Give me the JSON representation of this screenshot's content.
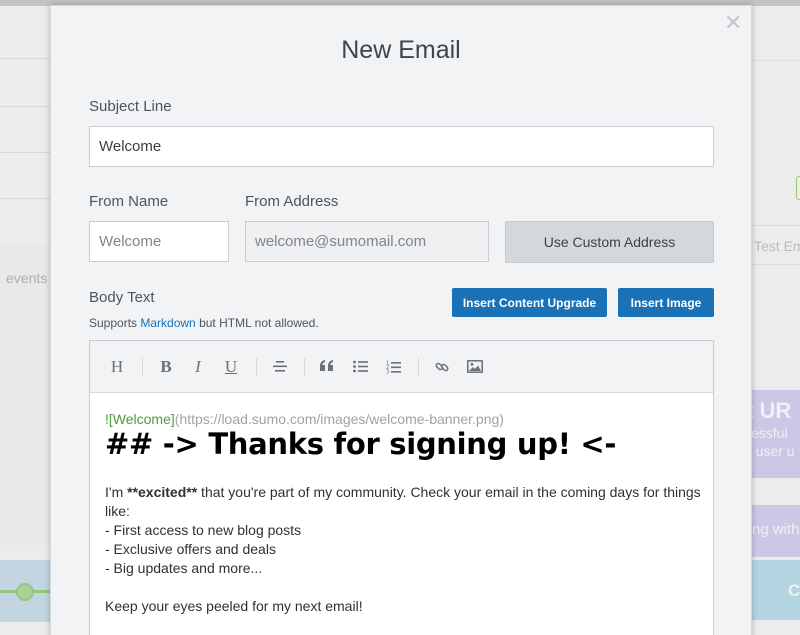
{
  "background": {
    "events_text": "events",
    "test_email_text": "Test Em",
    "purple_title": "t UR",
    "purple_line1": "cessful",
    "purple_line2": "e user u",
    "purple_button": "ng with",
    "cyan_button": "C"
  },
  "modal": {
    "title": "New Email",
    "close_symbol": "✕"
  },
  "subject": {
    "label": "Subject Line",
    "value": "Welcome"
  },
  "from_name": {
    "label": "From Name",
    "placeholder": "Welcome"
  },
  "from_address": {
    "label": "From Address",
    "placeholder": "welcome@sumomail.com"
  },
  "custom_address_button": "Use Custom Address",
  "body": {
    "label": "Body Text",
    "supports_prefix": "Supports ",
    "supports_link": "Markdown",
    "supports_suffix": " but HTML not allowed.",
    "insert_upgrade_button": "Insert Content Upgrade",
    "insert_image_button": "Insert Image"
  },
  "toolbar": {
    "heading": "H",
    "bold": "B",
    "italic": "I",
    "underline": "U",
    "icons": [
      "heading-icon",
      "bold-icon",
      "italic-icon",
      "underline-icon",
      "align-center-icon",
      "quote-icon",
      "bullet-list-icon",
      "numbered-list-icon",
      "link-icon",
      "image-icon"
    ]
  },
  "editor": {
    "image_alt": "![Welcome]",
    "image_url": "(https://load.sumo.com/images/welcome-banner.png)",
    "heading": "## -> Thanks for signing up! <-",
    "p1_prefix": "I'm ",
    "p1_bold": "**excited**",
    "p1_suffix": " that you're part of my community. Check your email in the coming days for things like:",
    "list": [
      "- First access to new blog posts",
      "- Exclusive offers and deals",
      "- Big updates and more..."
    ],
    "p2": "Keep your eyes peeled for my next email!"
  },
  "colors": {
    "primary_button": "#1a71b6",
    "link": "#1a71b6",
    "markdown_alt_green": "#4f9d3a"
  }
}
